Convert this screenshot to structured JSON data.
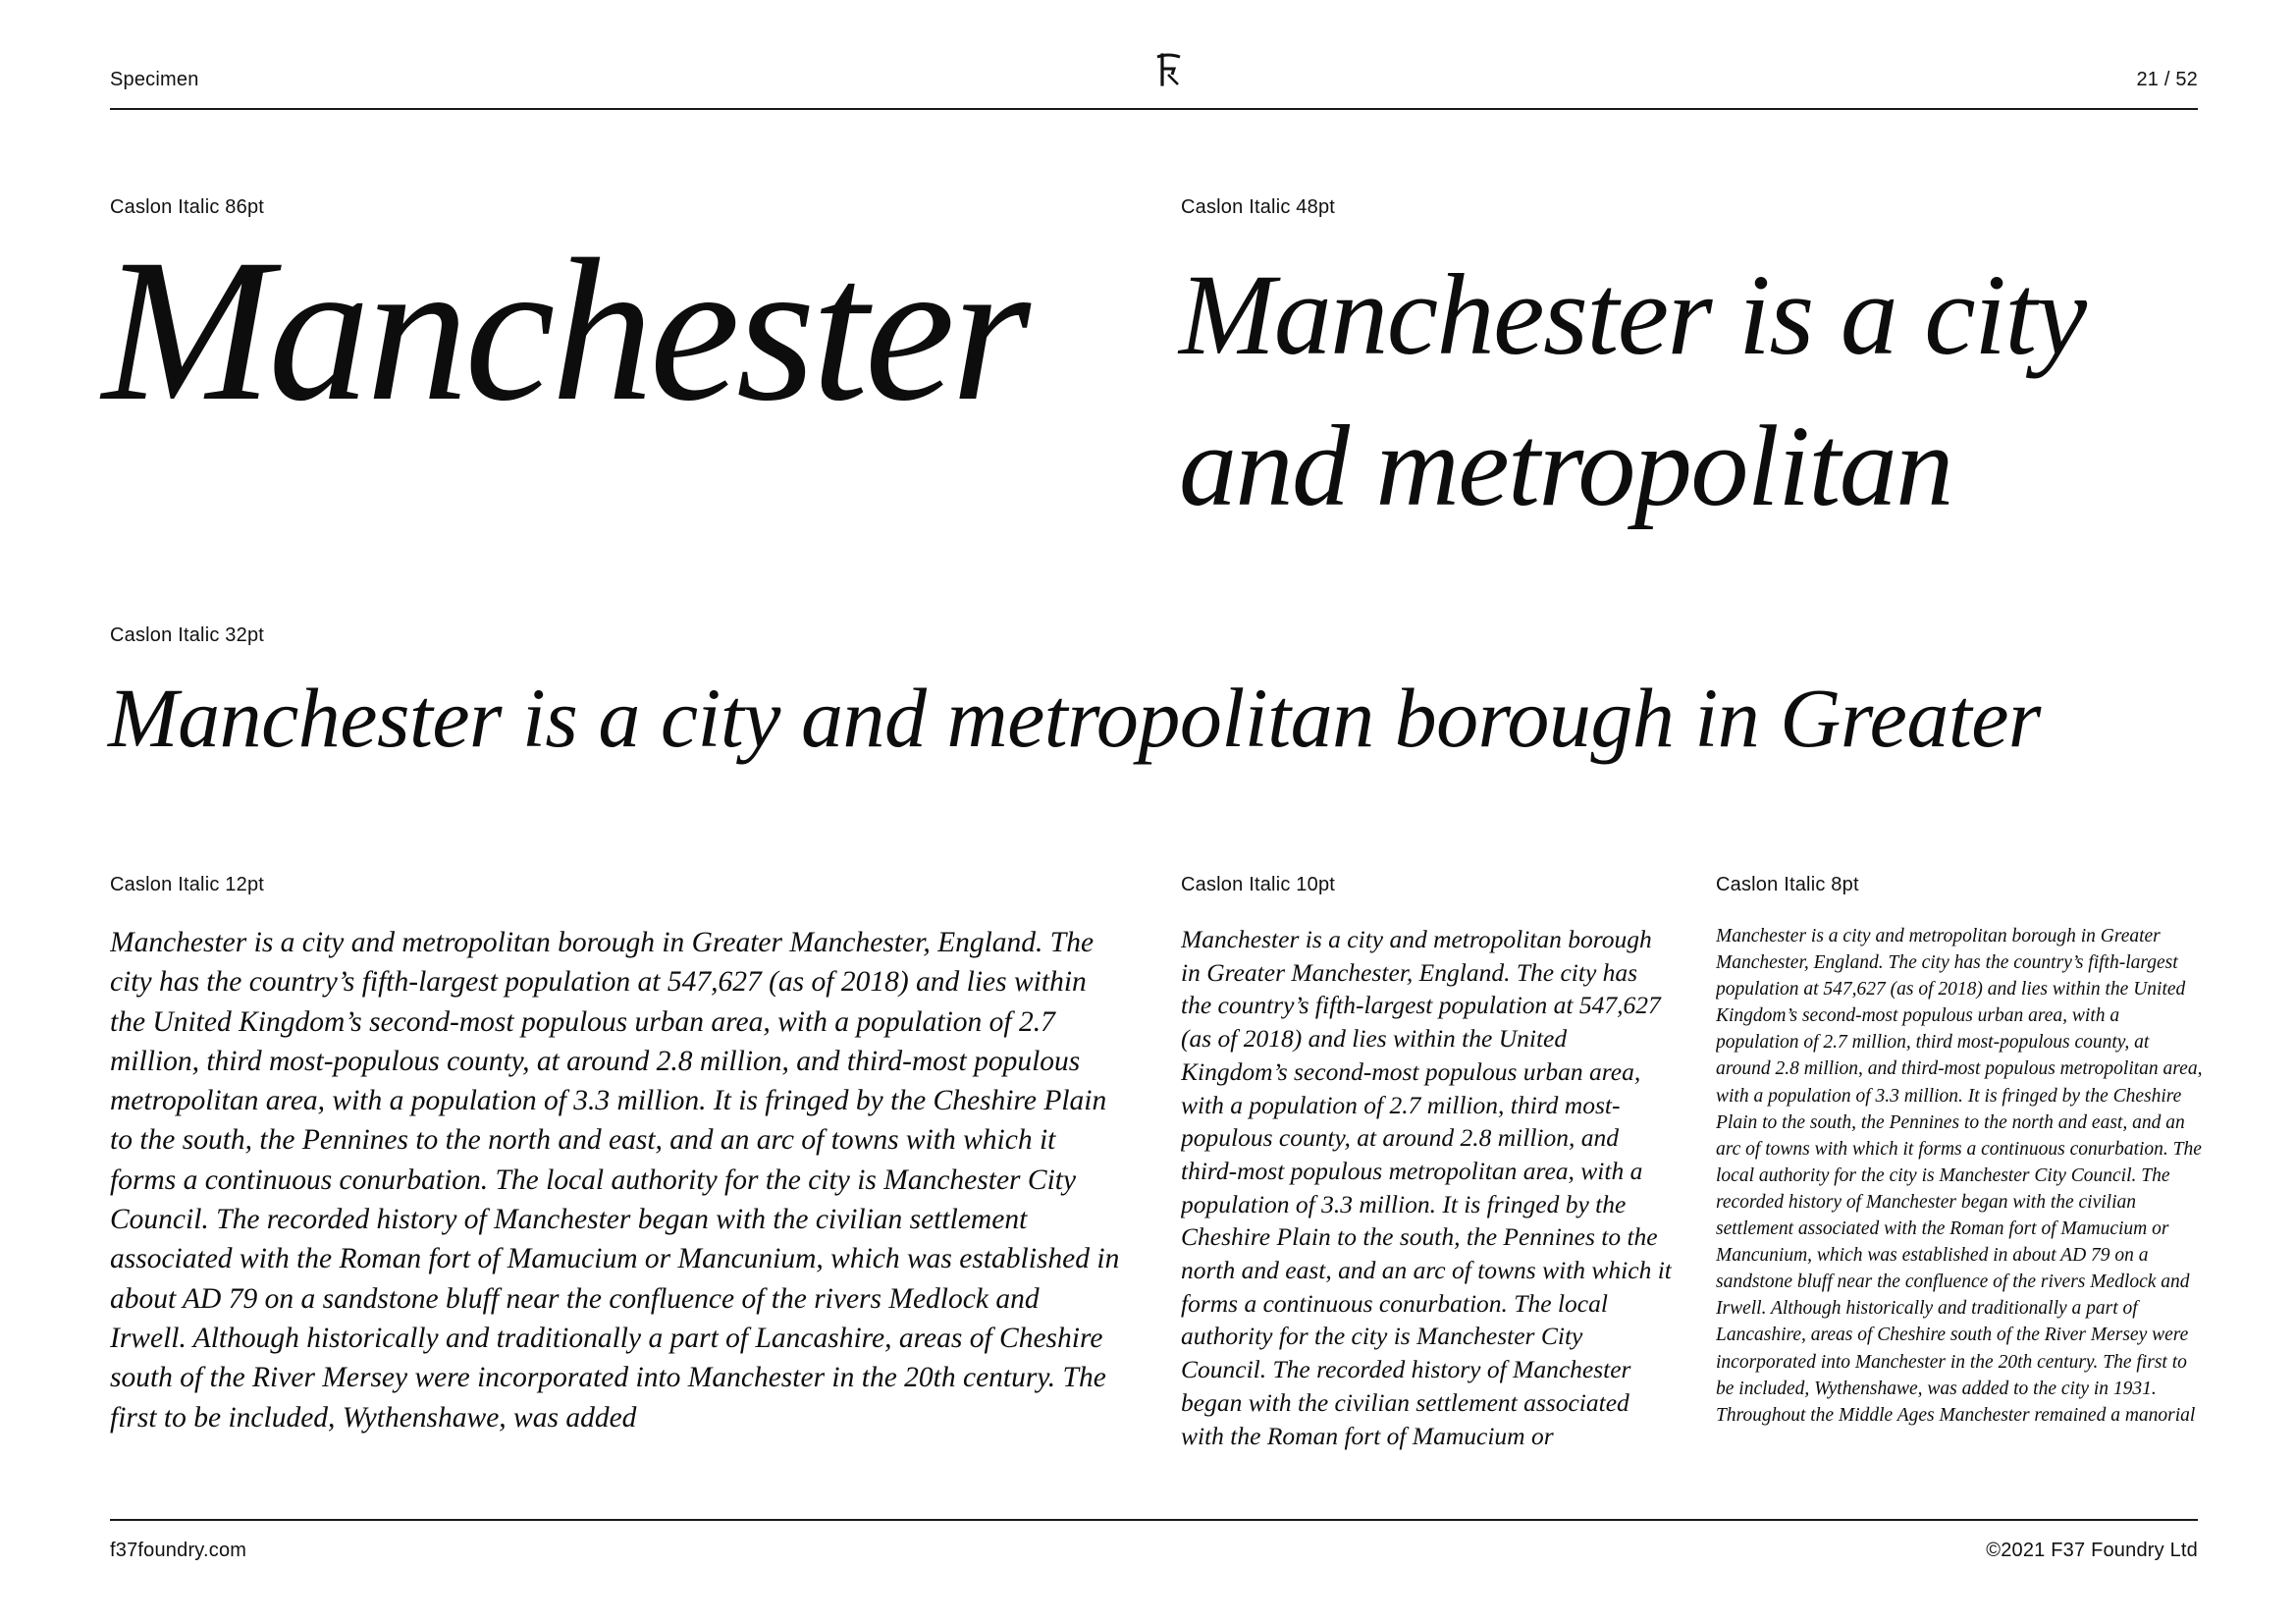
{
  "header": {
    "section": "Specimen",
    "page_indicator": "21 / 52",
    "logo_icon": "f37-logo-icon"
  },
  "specimens": {
    "s86": {
      "label": "Caslon Italic 86pt",
      "text": "Manchester"
    },
    "s48": {
      "label": "Caslon Italic 48pt",
      "text": "Manchester is a city and metropolitan"
    },
    "s32": {
      "label": "Caslon Italic 32pt",
      "text": "Manchester is a city and metropolitan borough in Greater"
    },
    "s12": {
      "label": "Caslon Italic 12pt",
      "text": "Manchester is a city and metropolitan borough in Greater Manchester, England. The city has the country’s fifth-largest population at 547,627 (as of 2018) and lies within the United Kingdom’s second-most populous urban area, with a population of 2.7 million, third most-populous county, at around 2.8 million, and third-most populous metropolitan area, with a population of 3.3 million. It is fringed by the Cheshire Plain to the south, the Pennines to the north and east, and an arc of towns with which it forms a continuous conurbation. The local authority for the city is Manchester City Council. The recorded history of Manchester began with the civilian settlement associated with the Roman fort of Mamucium or Mancunium, which was established in about AD 79 on a sandstone bluff near the confluence of the rivers Medlock and Irwell. Although historically and traditionally a part of Lancashire, areas of Cheshire south of the River Mersey were incorporated into Manchester in the 20th century. The first to be included, Wythenshawe, was added"
    },
    "s10": {
      "label": "Caslon Italic 10pt",
      "text": "Manchester is a city and metropolitan borough in Greater Manchester, England. The city has the country’s fifth-largest population at 547,627 (as of 2018) and lies within the United Kingdom’s second-most populous urban area, with a population of 2.7 million, third most-populous county, at around 2.8 million, and third-most populous metropolitan area, with a population of 3.3 million. It is fringed by the Cheshire Plain to the south, the Pennines to the north and east, and an arc of towns with which it forms a continuous conurbation. The local authority for the city is Manchester City Council. The recorded history of Manchester began with the civilian settlement associated with the Roman fort of Mamucium or"
    },
    "s8": {
      "label": "Caslon Italic 8pt",
      "text": "Manchester is a city and metropolitan borough in Greater Manchester, England. The city has the country’s fifth-largest population at 547,627 (as of 2018) and lies within the United Kingdom’s second-most populous urban area, with a population of 2.7 million, third most-populous county, at around 2.8 million, and third-most populous metropolitan area, with a population of 3.3 million. It is fringed by the Cheshire Plain to the south, the Pennines to the north and east, and an arc of towns with which it forms a continuous conurbation. The local authority for the city is Manchester City Council. The recorded history of Manchester began with the civilian settlement associated with the Roman fort of Mamucium or Mancunium, which was established in about AD 79 on a sandstone bluff near the confluence of the rivers Medlock and Irwell. Although historically and traditionally a part of Lancashire, areas of Cheshire south of the River Mersey were incorporated into Manchester in the 20th century. The first to be included, Wythenshawe, was added to the city in 1931. Throughout the Middle Ages Manchester remained a manorial"
    }
  },
  "footer": {
    "website": "f37foundry.com",
    "copyright": "©2021 F37 Foundry Ltd"
  },
  "colors": {
    "ink": "#111111",
    "background": "#ffffff"
  }
}
